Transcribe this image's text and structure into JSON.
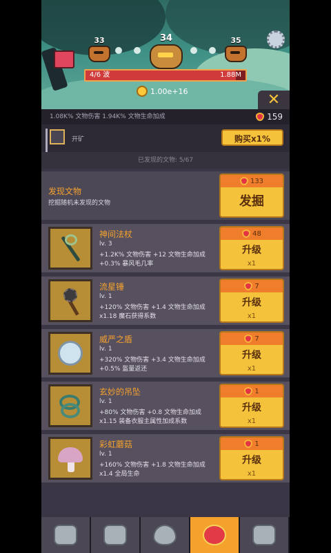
{
  "header": {
    "stages": {
      "prev": "33",
      "current": "34",
      "next": "35"
    },
    "wave_label": "4/6 波",
    "boss_hp": "1.88M",
    "boss_hp_fraction": 0.94,
    "gold": "1.00e+16",
    "close_symbol": "✕"
  },
  "stats_bar": {
    "text": "1.08K%  文物伤害   1.94K%   文物生命加成",
    "gems": "159"
  },
  "buy_row": {
    "item_label": "开矿",
    "buy_button": "购买x1%",
    "hint": "已发现的文物: 5/67"
  },
  "dig": {
    "title": "发现文物",
    "description": "挖掘随机未发现的文物",
    "cost": "133",
    "button": "发掘"
  },
  "items": [
    {
      "name": "神间法杖",
      "level": "lv. 3",
      "line1": "+1.2K% 文物伤害 +12 文物生命加成",
      "line2": "+0.3% 暴风毛几率",
      "cost": "48",
      "button": "升级",
      "mult": "x1"
    },
    {
      "name": "流星锤",
      "level": "lv. 1",
      "line1": "+120% 文物伤害 +1.4 文物生命加成",
      "line2": "x1.18 魔石获得系数",
      "cost": "7",
      "button": "升级",
      "mult": "x1"
    },
    {
      "name": "威严之盾",
      "level": "lv. 1",
      "line1": "+320% 文物伤害 +3.4 文物生命加成",
      "line2": "+0.5% 盔量返还",
      "cost": "7",
      "button": "升级",
      "mult": "x1"
    },
    {
      "name": "玄妙的吊坠",
      "level": "lv. 1",
      "line1": "+80% 文物伤害 +0.8 文物生命加成",
      "line2": "x1.15 装备衣服主属性加成系数",
      "cost": "1",
      "button": "升级",
      "mult": "x1"
    },
    {
      "name": "彩虹蘑菇",
      "level": "lv. 1",
      "line1": "+160% 文物伤害 +1.8 文物生命加成",
      "line2": "x1.4 全局生命",
      "cost": "1",
      "button": "升级",
      "mult": "x1"
    }
  ],
  "nav": [
    "helmet-icon",
    "armor-icon",
    "egg-icon",
    "ruby-icon",
    "chest-icon"
  ]
}
